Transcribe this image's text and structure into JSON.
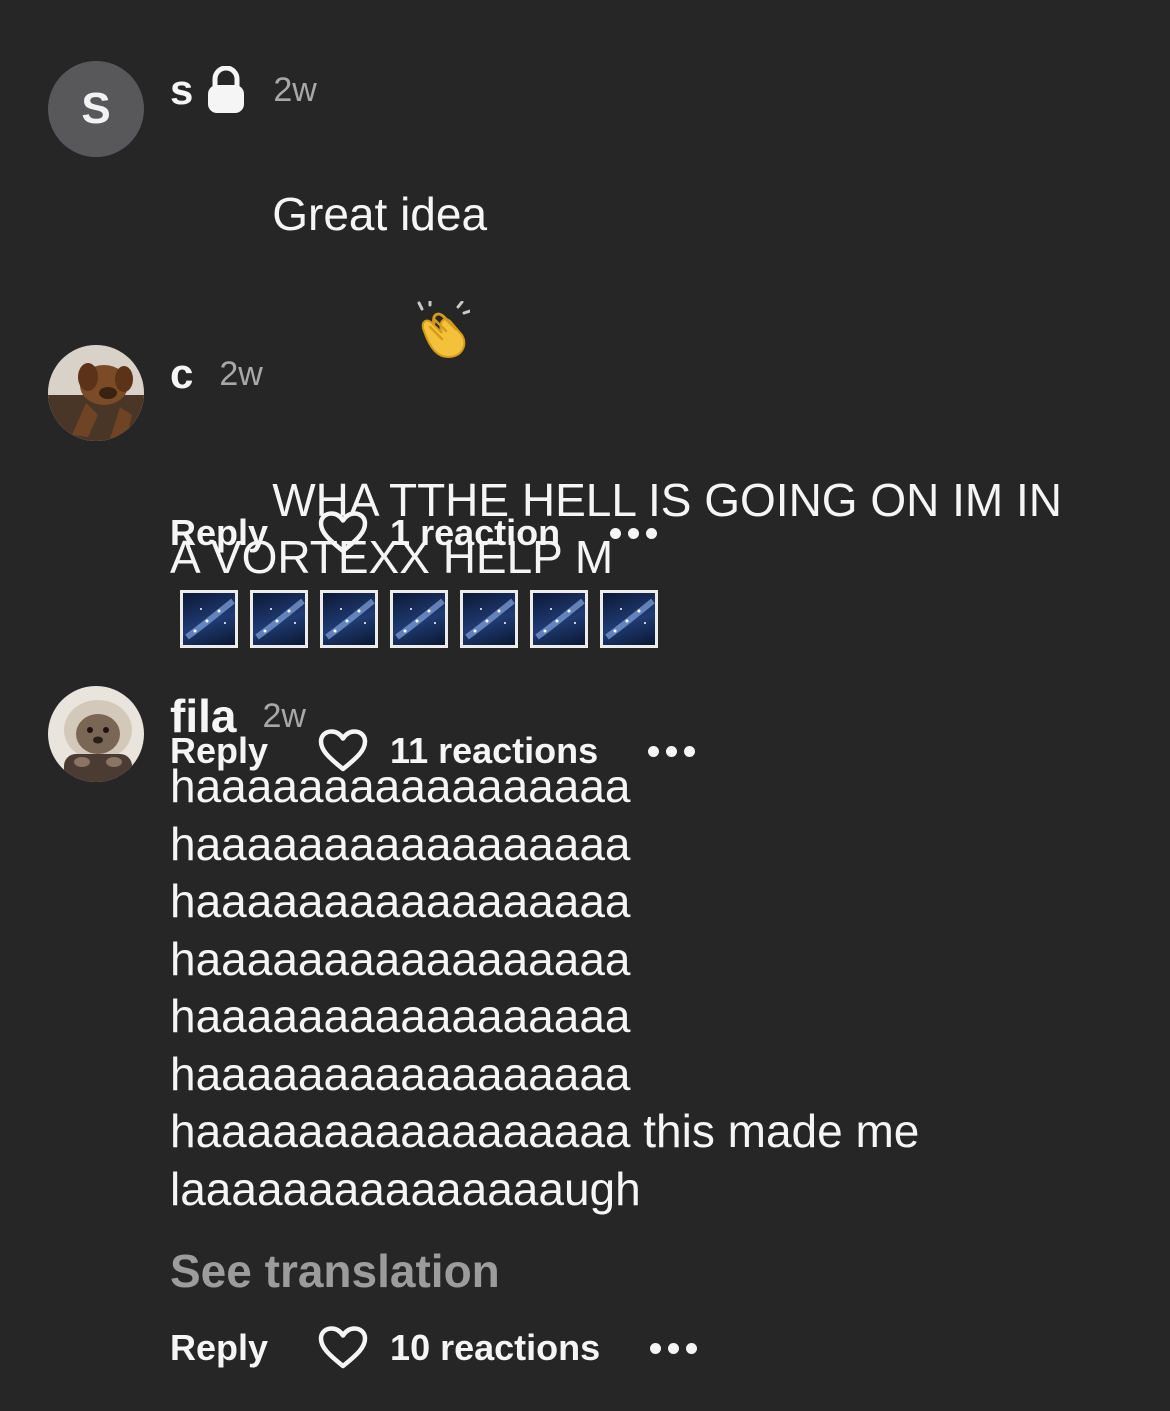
{
  "comments": [
    {
      "username": "s",
      "avatar_letter": "S",
      "lock_icon": "lock-icon",
      "time": "2w",
      "text": "Great idea",
      "emoji": "clapping-hands-icon",
      "reply_label": "Reply",
      "reactions": "1 reaction"
    },
    {
      "username": "c",
      "time": "2w",
      "text": "WHA TTHE HELL IS GOING ON IM IN A VORTEXX HELP M",
      "emoji": "milky-way-icon",
      "reply_label": "Reply",
      "reactions": "11 reactions"
    },
    {
      "username": "fila",
      "time": "2w",
      "text": "haaaaaaaaaaaaaaaaa\nhaaaaaaaaaaaaaaaaa\nhaaaaaaaaaaaaaaaaa\nhaaaaaaaaaaaaaaaaa\nhaaaaaaaaaaaaaaaaa\nhaaaaaaaaaaaaaaaaa\nhaaaaaaaaaaaaaaaaa this made me\nlaaaaaaaaaaaaaaaugh",
      "see_translation": "See translation",
      "reply_label": "Reply",
      "reactions": "10 reactions"
    }
  ],
  "colors": {
    "background": "#262627",
    "text": "#f5f5f5",
    "muted": "#a8a8a8",
    "translation": "#9c9c9c"
  }
}
